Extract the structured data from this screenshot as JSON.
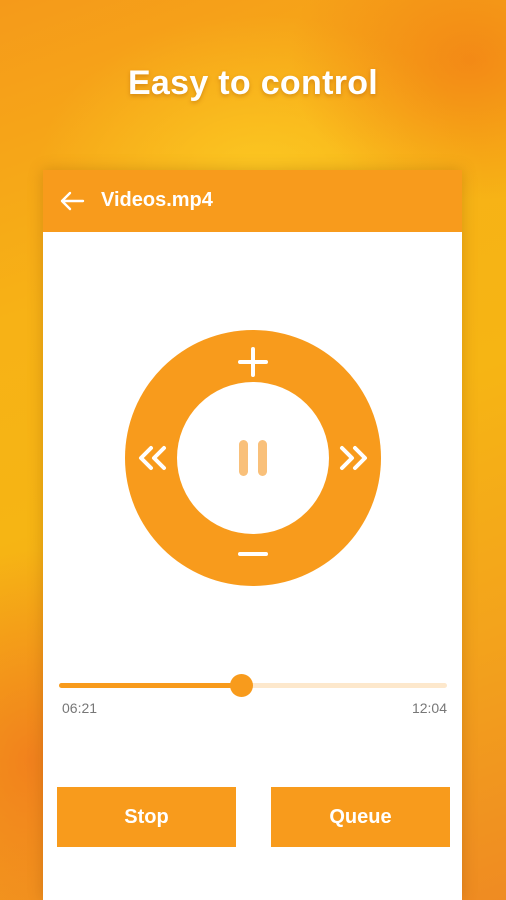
{
  "headline": "Easy to control",
  "appbar": {
    "back_icon": "arrow-left-icon",
    "title": "Videos.mp4"
  },
  "remote": {
    "icons": {
      "volume_up": "plus-icon",
      "volume_down": "minus-icon",
      "rewind": "double-chevron-left-icon",
      "forward": "double-chevron-right-icon",
      "play_pause": "pause-icon"
    }
  },
  "playback": {
    "current_time": "06:21",
    "total_time": "12:04",
    "progress_fraction": 0.47
  },
  "buttons": {
    "stop_label": "Stop",
    "queue_label": "Queue"
  },
  "colors": {
    "accent": "#f89b1c",
    "track": "#fde8cc",
    "pause_icon": "#f9c07a",
    "time_text": "#777777"
  }
}
